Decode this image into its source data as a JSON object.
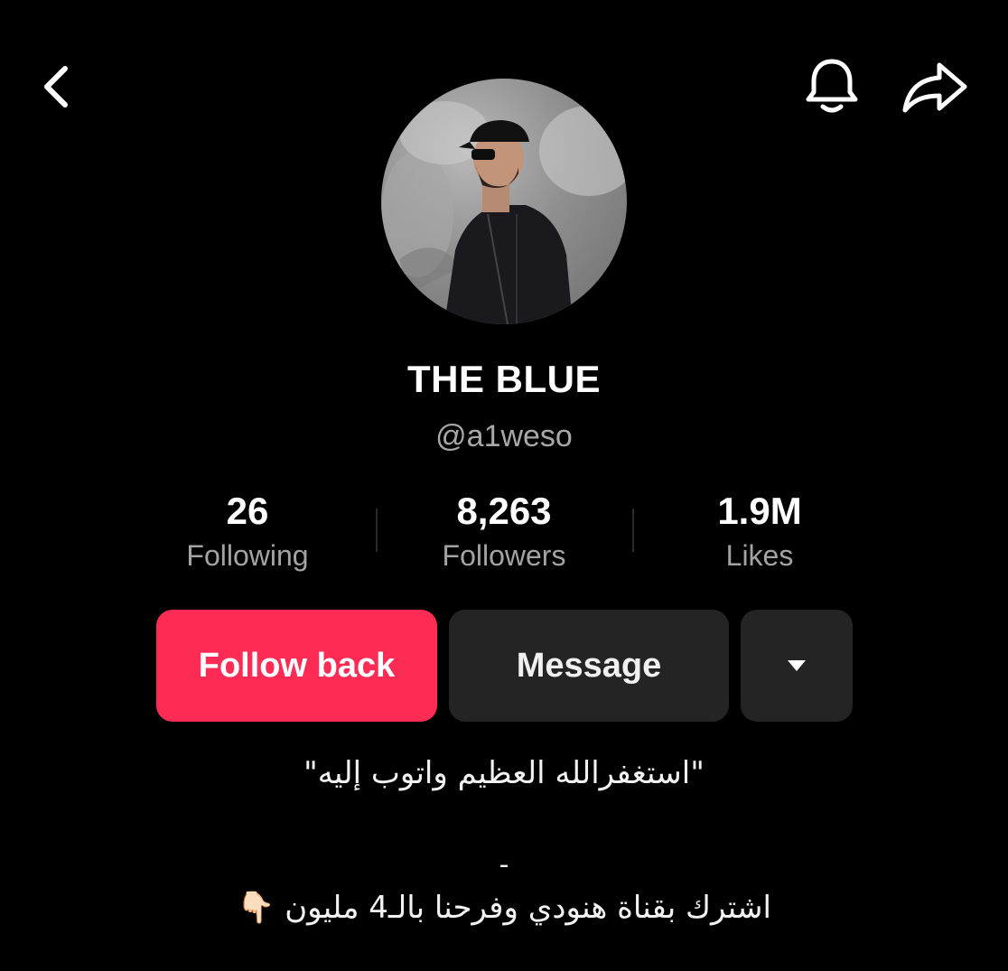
{
  "header": {
    "back_icon": "chevron-left-icon",
    "bell_icon": "bell-icon",
    "share_icon": "share-arrow-icon"
  },
  "profile": {
    "display_name": "THE BLUE",
    "username": "@a1weso"
  },
  "stats": [
    {
      "value": "26",
      "label": "Following"
    },
    {
      "value": "8,263",
      "label": "Followers"
    },
    {
      "value": "1.9M",
      "label": "Likes"
    }
  ],
  "actions": {
    "follow_back": "Follow back",
    "message": "Message",
    "more_icon": "triangle-down-icon"
  },
  "bio": {
    "line1": "\"استغفرالله العظيم واتوب إليه\"",
    "line2": "-",
    "line3": "اشترك بقناة هنودي وفرحنا بالـ4 مليون",
    "line3_emoji": "👇🏻"
  },
  "colors": {
    "background": "#000000",
    "accent": "#fe2c55",
    "secondary_button": "#242424",
    "muted_text": "#a8a8a8"
  }
}
